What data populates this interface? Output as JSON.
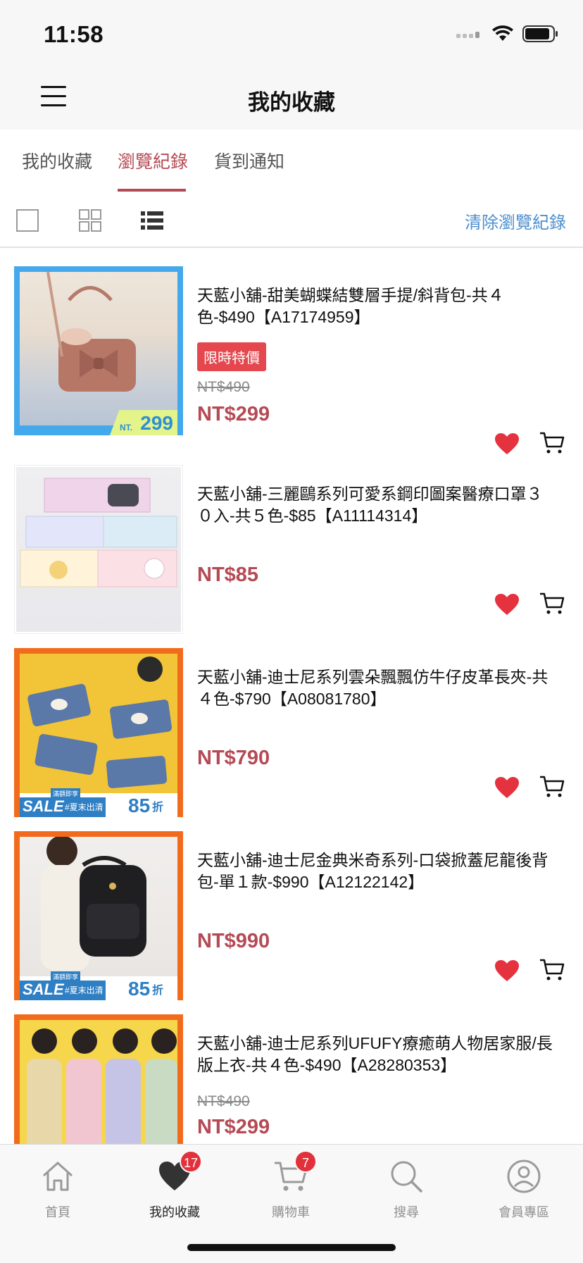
{
  "status_bar": {
    "time": "11:58"
  },
  "header": {
    "title": "我的收藏"
  },
  "tabs": [
    {
      "label": "我的收藏"
    },
    {
      "label": "瀏覽紀錄"
    },
    {
      "label": "貨到通知"
    }
  ],
  "toolbar": {
    "clear_label": "清除瀏覽紀錄"
  },
  "products": [
    {
      "title": "天藍小舖-甜美蝴蝶結雙層手提/斜背包-共４色-$490【A17174959】",
      "tag": "限時特價",
      "original_price": "NT$490",
      "price": "NT$299",
      "badge": {
        "prefix": "NT.",
        "value": "299"
      }
    },
    {
      "title": "天藍小舖-三麗鷗系列可愛系鋼印圖案醫療口罩３０入-共５色-$85【A11114314】",
      "price": "NT$85"
    },
    {
      "title": "天藍小舖-迪士尼系列雲朵飄飄仿牛仔皮革長夾-共４色-$790【A08081780】",
      "price": "NT$790",
      "badge": {
        "sale": "SALE",
        "sub": "#夏末出清",
        "mini": "滿額即享",
        "discount": "85",
        "unit": "折"
      }
    },
    {
      "title": "天藍小舖-迪士尼金典米奇系列-口袋掀蓋尼龍後背包-單１款-$990【A12122142】",
      "price": "NT$990",
      "badge": {
        "sale": "SALE",
        "sub": "#夏末出清",
        "mini": "滿額即享",
        "discount": "85",
        "unit": "折"
      }
    },
    {
      "title": "天藍小舖-迪士尼系列UFUFY療癒萌人物居家服/長版上衣-共４色-$490【A28280353】",
      "original_price": "NT$490",
      "price": "NT$299"
    }
  ],
  "tabbar": [
    {
      "label": "首頁",
      "icon": "home-icon"
    },
    {
      "label": "我的收藏",
      "icon": "heart-icon",
      "badge": "17"
    },
    {
      "label": "購物車",
      "icon": "cart-icon",
      "badge": "7"
    },
    {
      "label": "搜尋",
      "icon": "search-icon"
    },
    {
      "label": "會員專區",
      "icon": "user-icon"
    }
  ],
  "colors": {
    "accent": "#b54a55",
    "link": "#4d8fce",
    "heart": "#e5323f",
    "sale_tag": "#e5474f",
    "badge": "#e2313a"
  }
}
